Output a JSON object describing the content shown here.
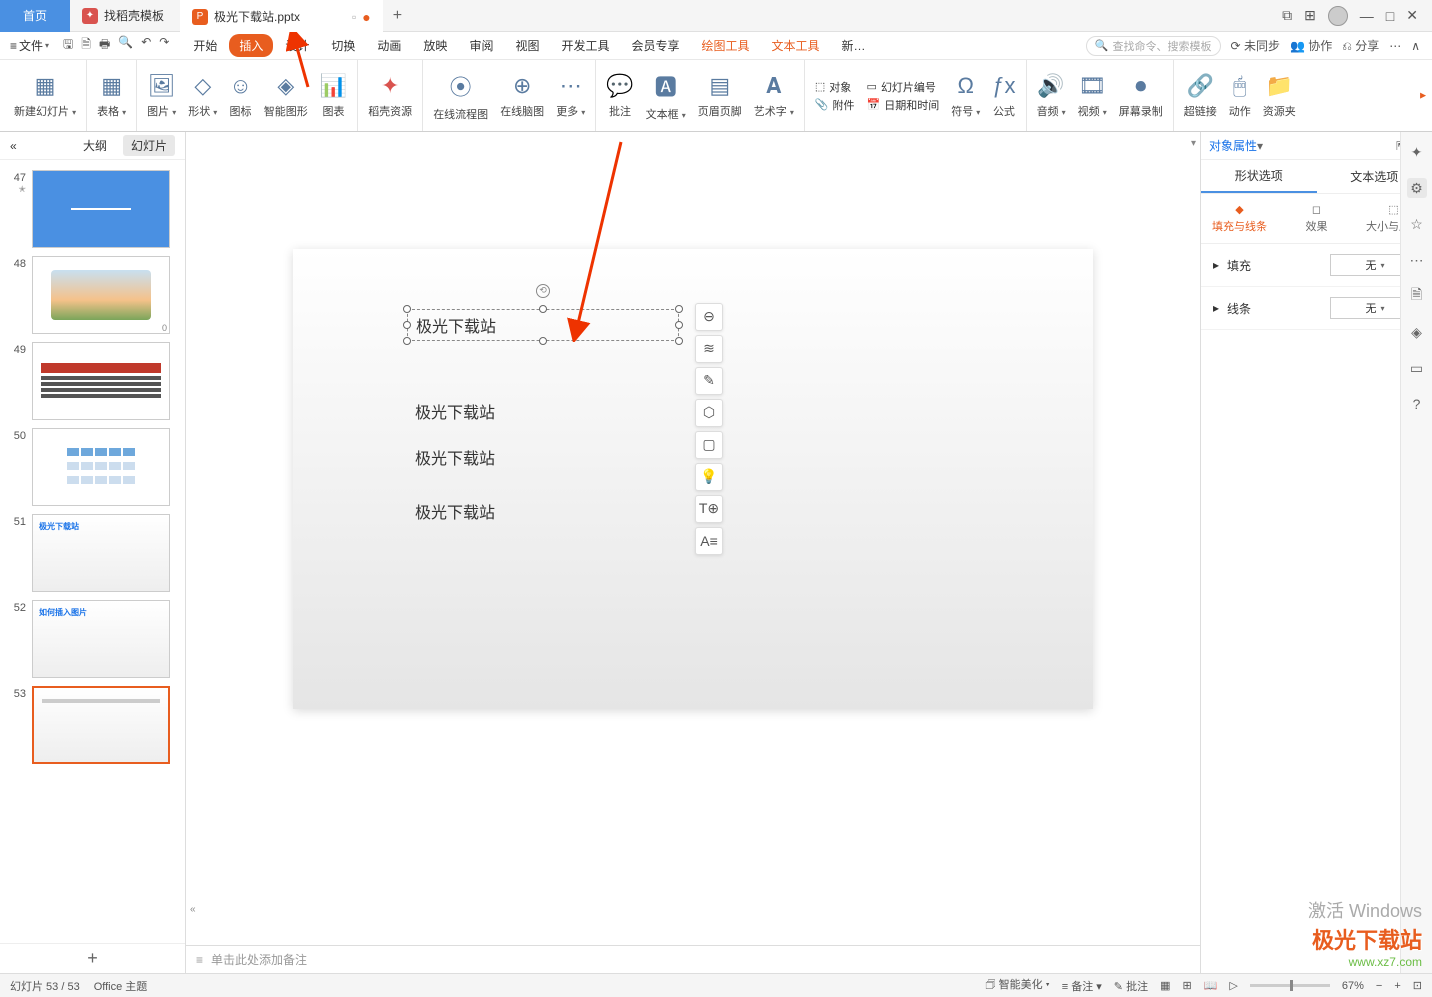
{
  "titlebar": {
    "home_tab": "首页",
    "template_tab": "找稻壳模板",
    "active_tab": "极光下载站.pptx",
    "add_tab": "+"
  },
  "menubar": {
    "file": "文件",
    "tabs": [
      "开始",
      "插入",
      "设计",
      "切换",
      "动画",
      "放映",
      "审阅",
      "视图",
      "开发工具",
      "会员专享"
    ],
    "active_tab": "插入",
    "context_tabs": [
      "绘图工具",
      "文本工具",
      "新…"
    ],
    "search_placeholder": "查找命令、搜索模板",
    "unsync": "未同步",
    "collab": "协作",
    "share": "分享"
  },
  "ribbon": {
    "new_slide": "新建幻灯片",
    "table": "表格",
    "picture": "图片",
    "shape": "形状",
    "icon": "图标",
    "smart_shape": "智能图形",
    "chart": "图表",
    "docer": "稻壳资源",
    "flow": "在线流程图",
    "mind": "在线脑图",
    "more": "更多",
    "comment": "批注",
    "textbox": "文本框",
    "header_footer": "页眉页脚",
    "wordart": "艺术字",
    "object": "对象",
    "attach": "附件",
    "slide_num": "幻灯片编号",
    "datetime": "日期和时间",
    "symbol": "符号",
    "equation": "公式",
    "audio": "音频",
    "video": "视频",
    "screen_rec": "屏幕录制",
    "hyperlink": "超链接",
    "action": "动作",
    "res_folder": "资源夹"
  },
  "slide_panel": {
    "outline_tab": "大纲",
    "slides_tab": "幻灯片",
    "slides": [
      {
        "num": "47"
      },
      {
        "num": "48"
      },
      {
        "num": "49"
      },
      {
        "num": "50"
      },
      {
        "num": "51",
        "title": "极光下载站"
      },
      {
        "num": "52",
        "title": "如何插入图片"
      },
      {
        "num": "53"
      }
    ]
  },
  "canvas": {
    "selected_text": "极光下载站",
    "lines": [
      "极光下载站",
      "极光下载站",
      "极光下载站"
    ],
    "notes_placeholder": "单击此处添加备注"
  },
  "right_pane": {
    "title": "对象属性",
    "tabs": [
      "形状选项",
      "文本选项"
    ],
    "subtabs": [
      "填充与线条",
      "效果",
      "大小与属性"
    ],
    "fill_label": "填充",
    "line_label": "线条",
    "none_value": "无"
  },
  "statusbar": {
    "slide_count": "幻灯片 53 / 53",
    "theme": "Office 主题",
    "beautify": "智能美化",
    "notes": "备注",
    "comments": "批注",
    "zoom": "67%"
  },
  "watermark": {
    "line1": "激活 Windows",
    "line2": "极光下载站",
    "line3": "www.xz7.com"
  }
}
